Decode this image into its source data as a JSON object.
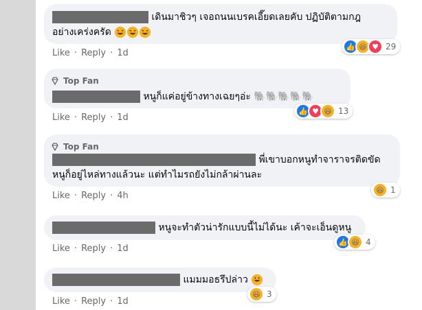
{
  "comments": [
    {
      "text": "เดินมาชิวๆ เจอถนนเบรคเอี๊ยดเลยคับ ปฏิบัติตามกฎ",
      "text2": "อย่างเคร่งครัด",
      "reactions_count": "29",
      "like": "Like",
      "reply": "Reply",
      "time": "1d"
    },
    {
      "badge": "Top Fan",
      "text": "หนูก็แค่อยู่ข้างทางเฉยๆอ่ะ 🐘🐘🐘🐘🐘",
      "reactions_count": "13",
      "like": "Like",
      "reply": "Reply",
      "time": "1d"
    },
    {
      "badge": "Top Fan",
      "text": "พี่เขาบอกหนูทำจาราจรติดขัด",
      "text2": "หนูก็อยู่ไหล่ทางแล้วนะ แต่ทำไมรถยังไม่กล้าผ่านละ",
      "reactions_count": "1",
      "like": "Like",
      "reply": "Reply",
      "time": "4h"
    },
    {
      "text": "หนูจะทำตัวน่ารักแบบนี้ไม่ได้นะ เค้าจะเอ็นดูหนู",
      "reactions_count": "4",
      "like": "Like",
      "reply": "Reply",
      "time": "1d"
    },
    {
      "text": "แมมมอธรึปล่าว",
      "reactions_count": "3",
      "like": "Like",
      "reply": "Reply",
      "time": "1d"
    }
  ],
  "separator": "·",
  "colors": {
    "bubble": "#f0f2f5",
    "like": "#1877f2",
    "haha": "#f7b125",
    "love": "#f33e58",
    "meta": "#65676b"
  }
}
